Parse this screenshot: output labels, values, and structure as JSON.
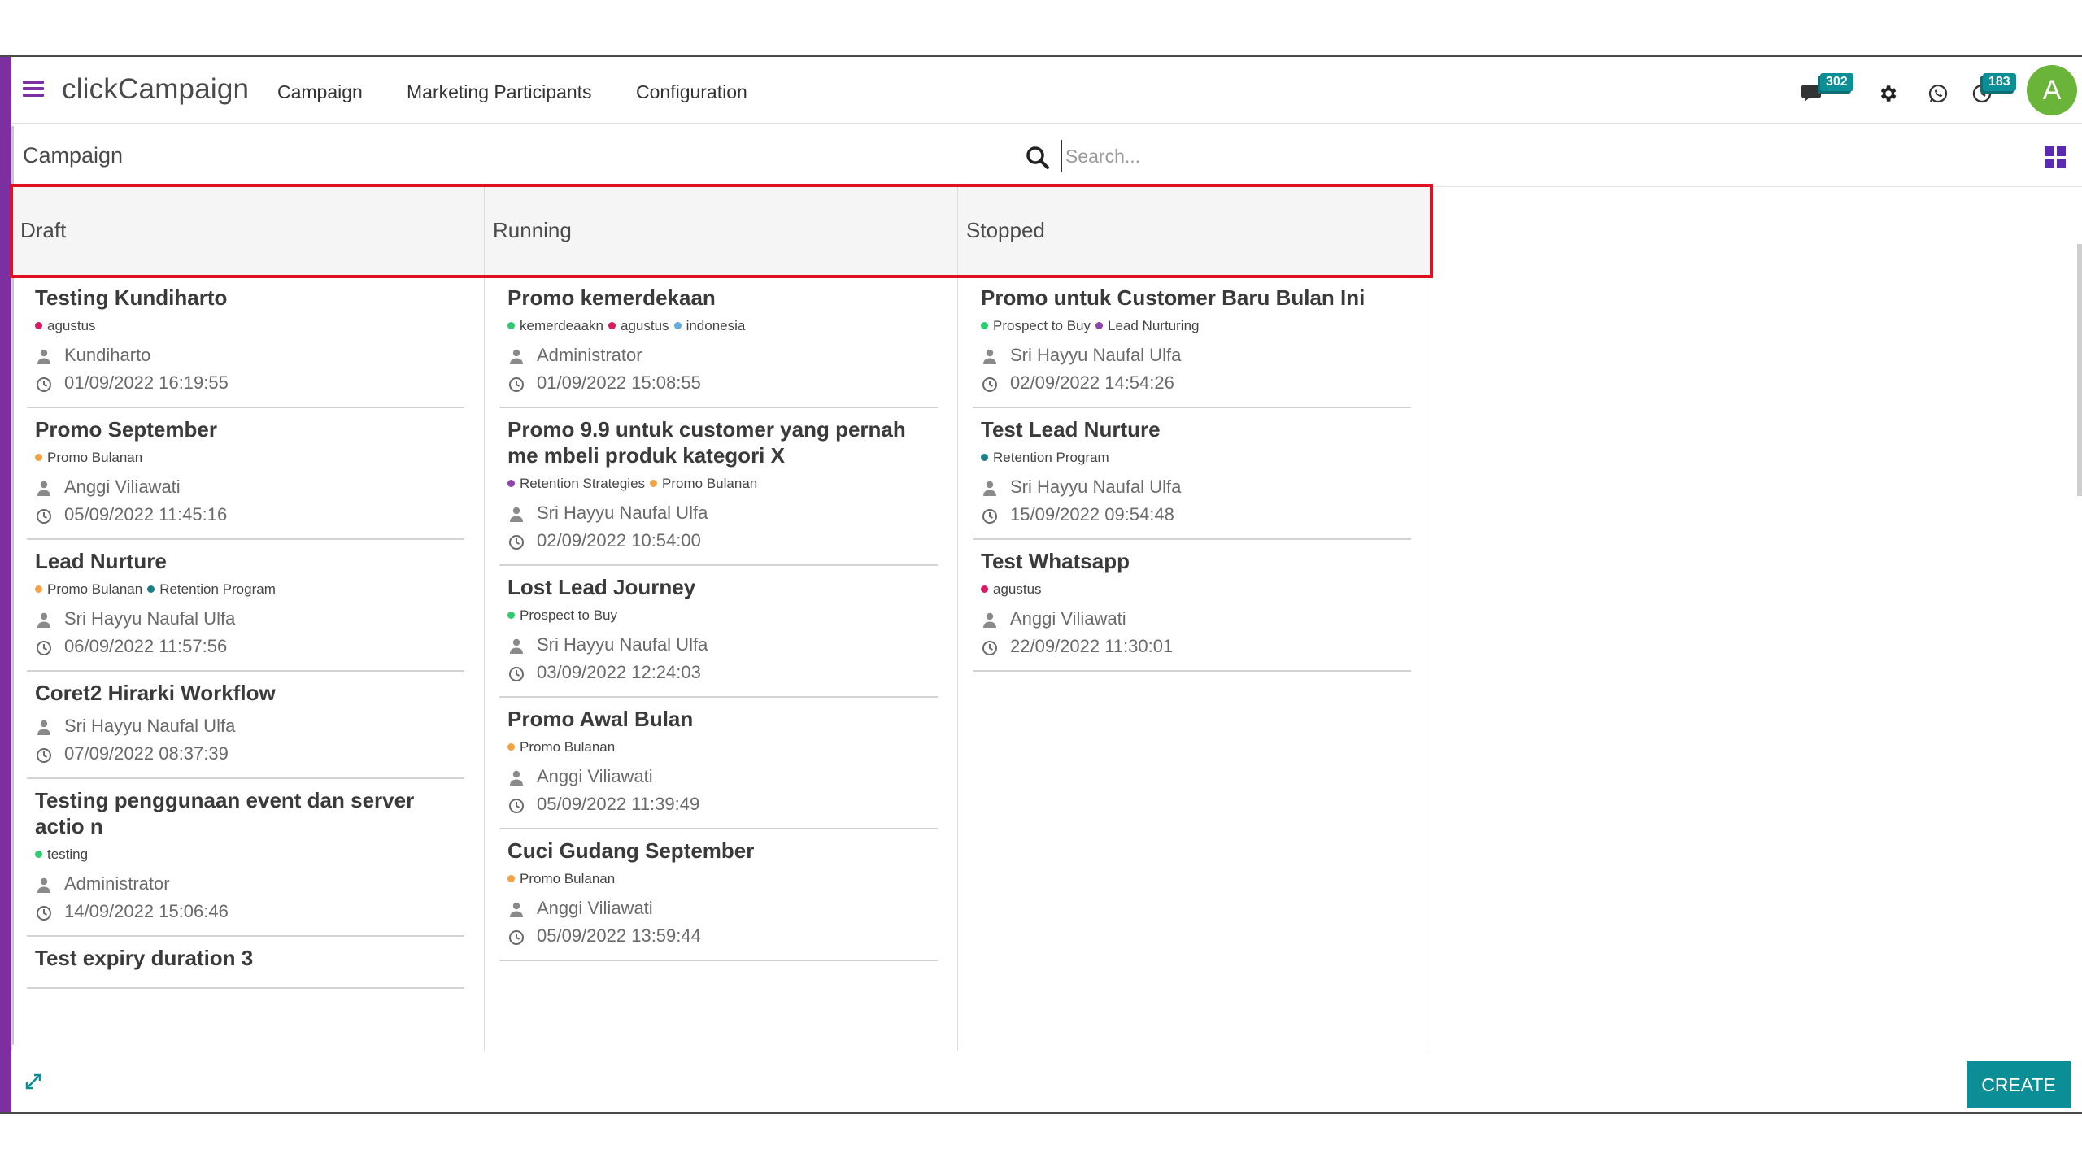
{
  "navbar": {
    "brand": "clickCampaign",
    "menu": [
      {
        "label": "Campaign"
      },
      {
        "label": "Marketing Participants"
      },
      {
        "label": "Configuration"
      }
    ],
    "messages_badge": "302",
    "activity_badge": "183",
    "avatar_initial": "A"
  },
  "control": {
    "breadcrumb": "Campaign",
    "search_placeholder": "Search..."
  },
  "columns": [
    {
      "title": "Draft",
      "cards": [
        {
          "title": "Testing Kundiharto",
          "tags": [
            {
              "name": "agustus",
              "color": "#d81b60"
            }
          ],
          "user": "Kundiharto",
          "date": "01/09/2022 16:19:55"
        },
        {
          "title": "Promo September",
          "tags": [
            {
              "name": "Promo Bulanan",
              "color": "#f4a340"
            }
          ],
          "user": "Anggi Viliawati",
          "date": "05/09/2022 11:45:16"
        },
        {
          "title": "Lead Nurture",
          "tags": [
            {
              "name": "Promo Bulanan",
              "color": "#f4a340"
            },
            {
              "name": "Retention Program",
              "color": "#1e7f86"
            }
          ],
          "user": "Sri Hayyu Naufal Ulfa",
          "date": "06/09/2022 11:57:56"
        },
        {
          "title": "Coret2 Hirarki Workflow",
          "tags": [],
          "user": "Sri Hayyu Naufal Ulfa",
          "date": "07/09/2022 08:37:39"
        },
        {
          "title": "Testing penggunaan event dan server actio n",
          "tags": [
            {
              "name": "testing",
              "color": "#2ecc71"
            }
          ],
          "user": "Administrator",
          "date": "14/09/2022 15:06:46"
        },
        {
          "title": "Test expiry duration 3",
          "tags": [],
          "user": "",
          "date": ""
        }
      ]
    },
    {
      "title": "Running",
      "cards": [
        {
          "title": "Promo kemerdekaan",
          "tags": [
            {
              "name": "kemerdeaakn",
              "color": "#2ecc71"
            },
            {
              "name": "agustus",
              "color": "#d81b60"
            },
            {
              "name": "indonesia",
              "color": "#5dade2"
            }
          ],
          "user": "Administrator",
          "date": "01/09/2022 15:08:55"
        },
        {
          "title": "Promo 9.9 untuk customer yang pernah me mbeli produk kategori X",
          "tags": [
            {
              "name": "Retention Strategies",
              "color": "#8e44ad"
            },
            {
              "name": "Promo Bulanan",
              "color": "#f4a340"
            }
          ],
          "user": "Sri Hayyu Naufal Ulfa",
          "date": "02/09/2022 10:54:00"
        },
        {
          "title": "Lost Lead Journey",
          "tags": [
            {
              "name": "Prospect to Buy",
              "color": "#2ecc71"
            }
          ],
          "user": "Sri Hayyu Naufal Ulfa",
          "date": "03/09/2022 12:24:03"
        },
        {
          "title": "Promo Awal Bulan",
          "tags": [
            {
              "name": "Promo Bulanan",
              "color": "#f4a340"
            }
          ],
          "user": "Anggi Viliawati",
          "date": "05/09/2022 11:39:49"
        },
        {
          "title": "Cuci Gudang September",
          "tags": [
            {
              "name": "Promo Bulanan",
              "color": "#f4a340"
            }
          ],
          "user": "Anggi Viliawati",
          "date": "05/09/2022 13:59:44"
        }
      ]
    },
    {
      "title": "Stopped",
      "cards": [
        {
          "title": "Promo untuk Customer Baru Bulan Ini",
          "tags": [
            {
              "name": "Prospect to Buy",
              "color": "#2ecc71"
            },
            {
              "name": "Lead Nurturing",
              "color": "#8e44ad"
            }
          ],
          "user": "Sri Hayyu Naufal Ulfa",
          "date": "02/09/2022 14:54:26"
        },
        {
          "title": "Test Lead Nurture",
          "tags": [
            {
              "name": "Retention Program",
              "color": "#1e7f86"
            }
          ],
          "user": "Sri Hayyu Naufal Ulfa",
          "date": "15/09/2022 09:54:48"
        },
        {
          "title": "Test Whatsapp",
          "tags": [
            {
              "name": "agustus",
              "color": "#d81b60"
            }
          ],
          "user": "Anggi Viliawati",
          "date": "22/09/2022 11:30:01"
        }
      ]
    }
  ],
  "footer": {
    "create_label": "CREATE"
  },
  "colors": {
    "accent": "#7b2fa0",
    "primary_button": "#0b8e95",
    "highlight_box": "#e01020",
    "avatar": "#6ab43a"
  }
}
